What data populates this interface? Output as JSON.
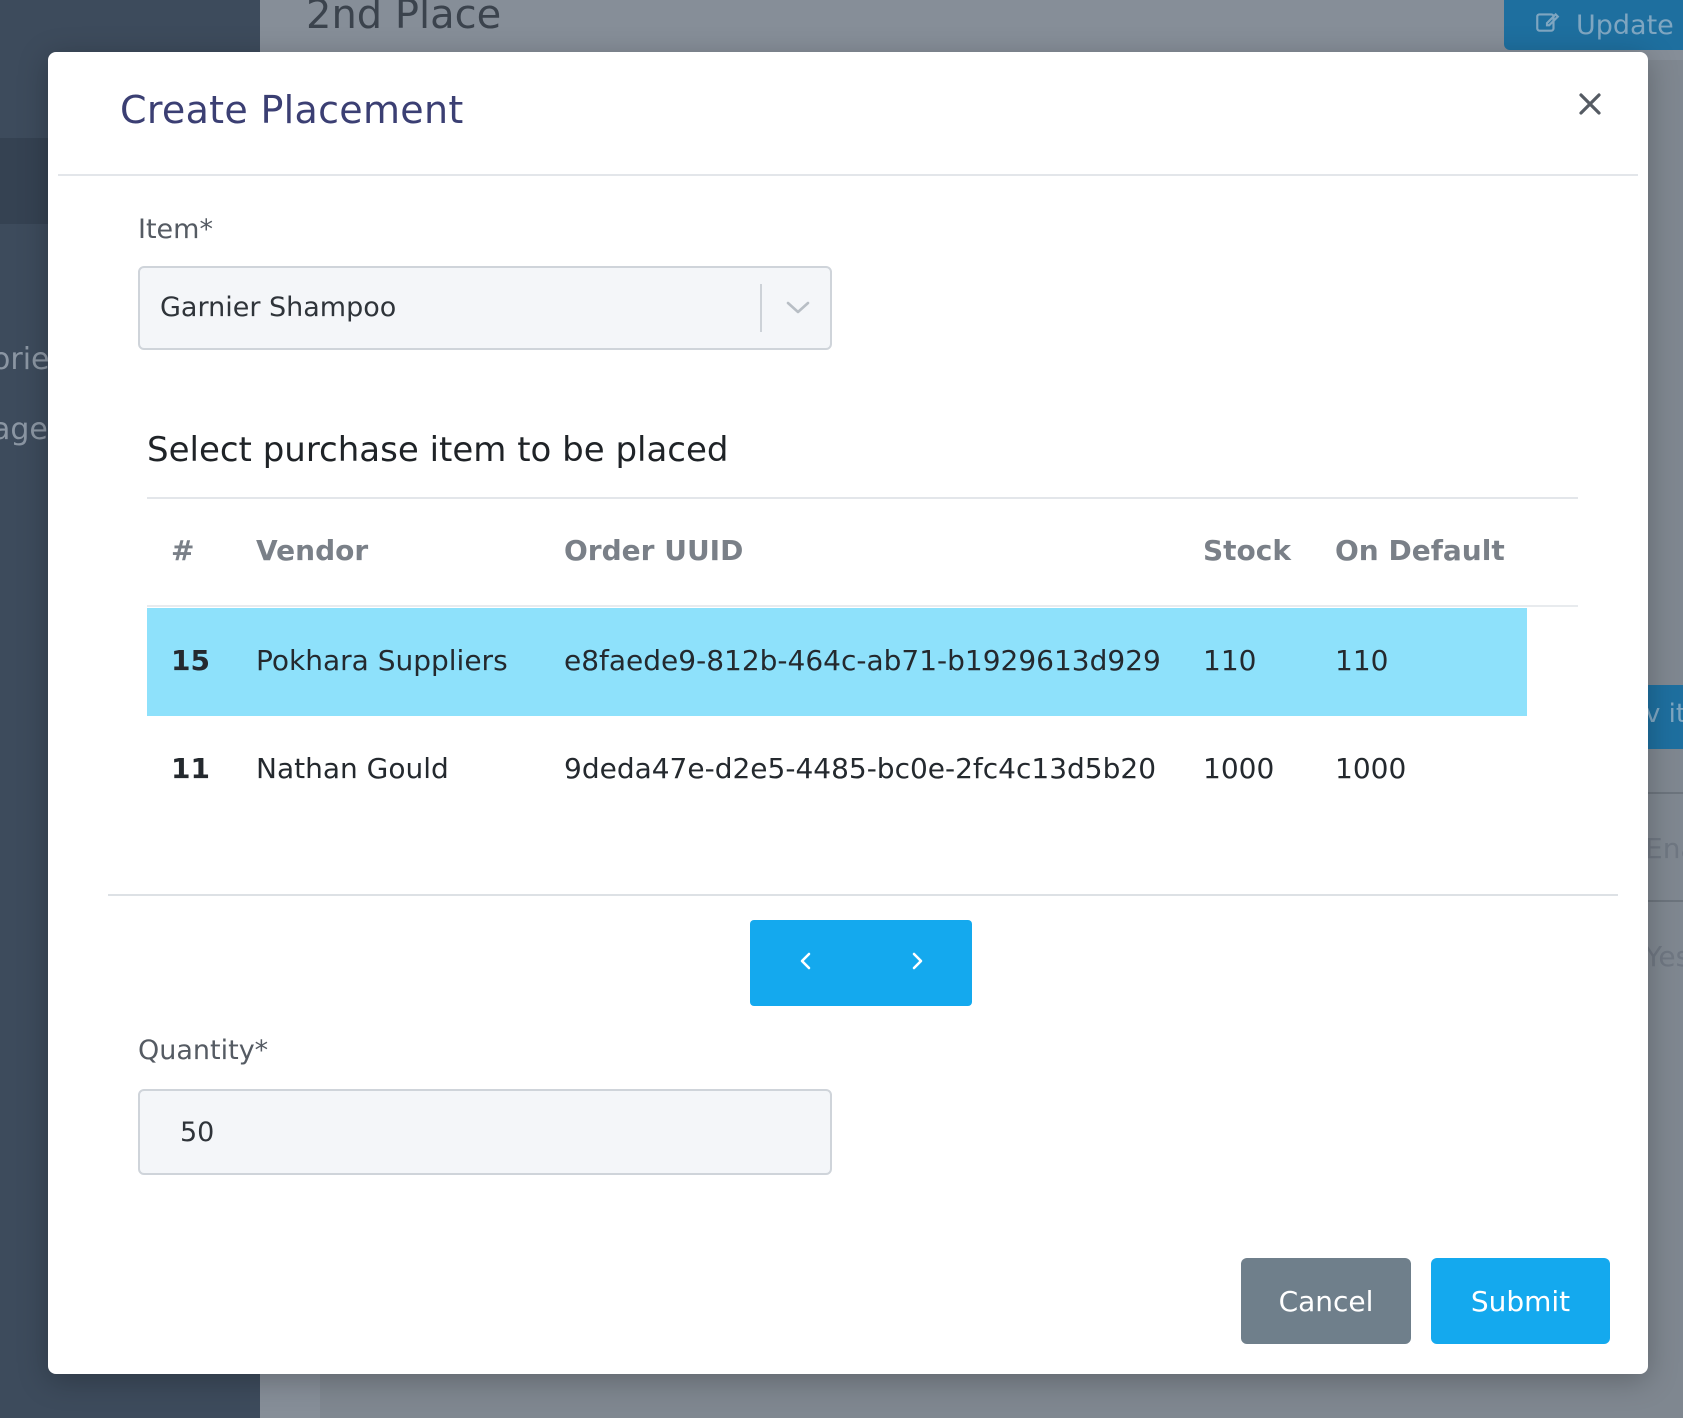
{
  "background": {
    "page_title": "2nd Place",
    "update_button_label": "Update",
    "sidebar_fragments": [
      "orie",
      "ager"
    ],
    "right_fragments": [
      "v it",
      "Ena",
      "Yes"
    ]
  },
  "modal": {
    "title": "Create Placement",
    "item_field": {
      "label": "Item*",
      "selected_value": "Garnier Shampoo"
    },
    "purchase_section": {
      "title": "Select purchase item to be placed",
      "columns": [
        "#",
        "Vendor",
        "Order UUID",
        "Stock",
        "On Default"
      ],
      "rows": [
        {
          "id": "15",
          "vendor": "Pokhara Suppliers",
          "order_uuid": "e8faede9-812b-464c-ab71-b1929613d929",
          "stock": "110",
          "on_default": "110",
          "selected": true
        },
        {
          "id": "11",
          "vendor": "Nathan Gould",
          "order_uuid": "9deda47e-d2e5-4485-bc0e-2fc4c13d5b20",
          "stock": "1000",
          "on_default": "1000",
          "selected": false
        }
      ]
    },
    "quantity_field": {
      "label": "Quantity*",
      "value": "50"
    },
    "buttons": {
      "cancel": "Cancel",
      "submit": "Submit"
    }
  },
  "colors": {
    "accent": "#14a9ee",
    "selected_row": "#8ee1fb",
    "title": "#3b3f73",
    "cancel": "#6f7f8b"
  }
}
